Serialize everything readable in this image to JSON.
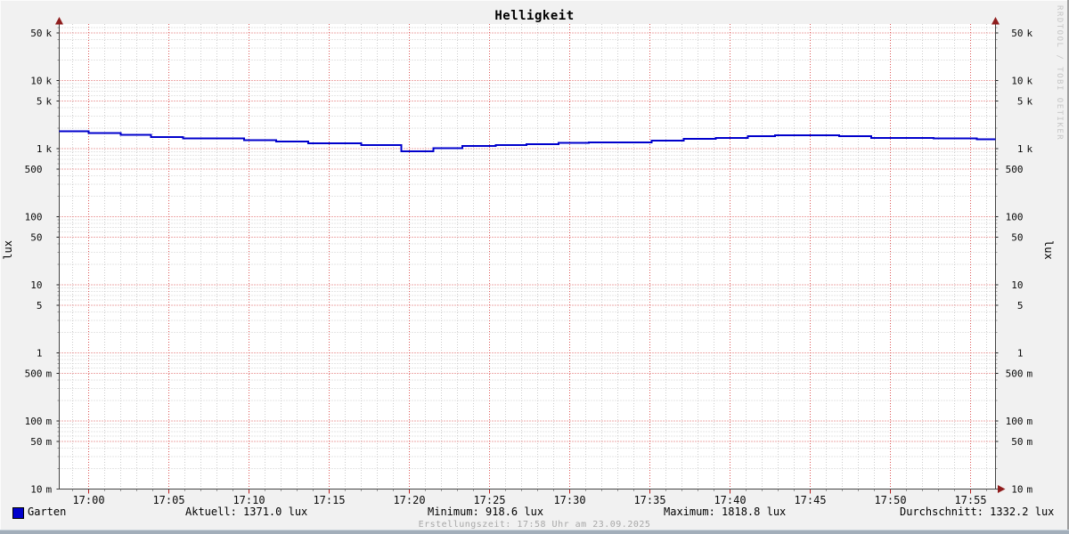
{
  "title": "Helligkeit",
  "ylabel_left": "lux",
  "ylabel_right": "lux",
  "watermark": "RRDTOOL / TOBI OETIKER",
  "legend": {
    "series_name": "Garten",
    "aktuell": "Aktuell: 1371.0 lux",
    "minimum": "Minimum: 918.6 lux",
    "maximum": "Maximum: 1818.8 lux",
    "durchschnitt": "Durchschnitt: 1332.2 lux"
  },
  "footer": {
    "created": "Erstellungszeit: 17:58 Uhr am 23.09.2025"
  },
  "colors": {
    "background": "#f1f1f1",
    "canvas": "#ffffff",
    "line": "#0000cc",
    "legend_swatch": "#0000cc",
    "major_grid": "#dd5555",
    "minor_grid": "#cdcdcd",
    "axis": "#444444",
    "arrow": "#8f1d1d",
    "major_tick_x": "#bb2222",
    "minor_tick": "#999999"
  },
  "chart_data": {
    "type": "line",
    "title": "Helligkeit",
    "ylabel": "lux",
    "yscale": "log",
    "ylim": [
      0.01,
      66000
    ],
    "x_range_minutes": [
      -1.85,
      56.6
    ],
    "grid": "major red dotted at 1/5 per decade and every 5 min; minor gray dotted at 2-4,6-9 per decade and every minute",
    "legend_position": "bottom",
    "y_ticks": [
      {
        "v": 0.01,
        "num": "10",
        "unit": "m"
      },
      {
        "v": 0.05,
        "num": "50",
        "unit": "m"
      },
      {
        "v": 0.1,
        "num": "100",
        "unit": "m"
      },
      {
        "v": 0.5,
        "num": "500",
        "unit": "m"
      },
      {
        "v": 1,
        "num": "1",
        "unit": ""
      },
      {
        "v": 5,
        "num": "5",
        "unit": ""
      },
      {
        "v": 10,
        "num": "10",
        "unit": ""
      },
      {
        "v": 50,
        "num": "50",
        "unit": ""
      },
      {
        "v": 100,
        "num": "100",
        "unit": ""
      },
      {
        "v": 500,
        "num": "500",
        "unit": ""
      },
      {
        "v": 1000,
        "num": "1",
        "unit": "k"
      },
      {
        "v": 5000,
        "num": "5",
        "unit": "k"
      },
      {
        "v": 10000,
        "num": "10",
        "unit": "k"
      },
      {
        "v": 50000,
        "num": "50",
        "unit": "k"
      }
    ],
    "x_ticks": [
      {
        "t": 0,
        "label": "17:00"
      },
      {
        "t": 5,
        "label": "17:05"
      },
      {
        "t": 10,
        "label": "17:10"
      },
      {
        "t": 15,
        "label": "17:15"
      },
      {
        "t": 20,
        "label": "17:20"
      },
      {
        "t": 25,
        "label": "17:25"
      },
      {
        "t": 30,
        "label": "17:30"
      },
      {
        "t": 35,
        "label": "17:35"
      },
      {
        "t": 40,
        "label": "17:40"
      },
      {
        "t": 45,
        "label": "17:45"
      },
      {
        "t": 50,
        "label": "17:50"
      },
      {
        "t": 55,
        "label": "17:55"
      }
    ],
    "series": [
      {
        "name": "Garten",
        "color": "#0000cc",
        "unit": "lux",
        "draw_style": "step",
        "end_t": 56.6,
        "step_points": [
          [
            -1.85,
            1810
          ],
          [
            0.0,
            1700
          ],
          [
            2.0,
            1600
          ],
          [
            3.9,
            1490
          ],
          [
            5.9,
            1415
          ],
          [
            9.7,
            1330
          ],
          [
            11.7,
            1265
          ],
          [
            13.7,
            1205
          ],
          [
            17.0,
            1135
          ],
          [
            19.5,
            918.6
          ],
          [
            21.5,
            1015
          ],
          [
            23.3,
            1100
          ],
          [
            25.4,
            1125
          ],
          [
            27.3,
            1155
          ],
          [
            29.3,
            1215
          ],
          [
            31.2,
            1240
          ],
          [
            35.1,
            1320
          ],
          [
            37.1,
            1390
          ],
          [
            39.1,
            1430
          ],
          [
            41.1,
            1520
          ],
          [
            42.8,
            1565
          ],
          [
            46.8,
            1520
          ],
          [
            48.8,
            1430
          ],
          [
            52.7,
            1405
          ],
          [
            55.4,
            1371
          ]
        ]
      }
    ],
    "stats": {
      "aktuell": 1371.0,
      "minimum": 918.6,
      "maximum": 1818.8,
      "durchschnitt": 1332.2
    }
  }
}
